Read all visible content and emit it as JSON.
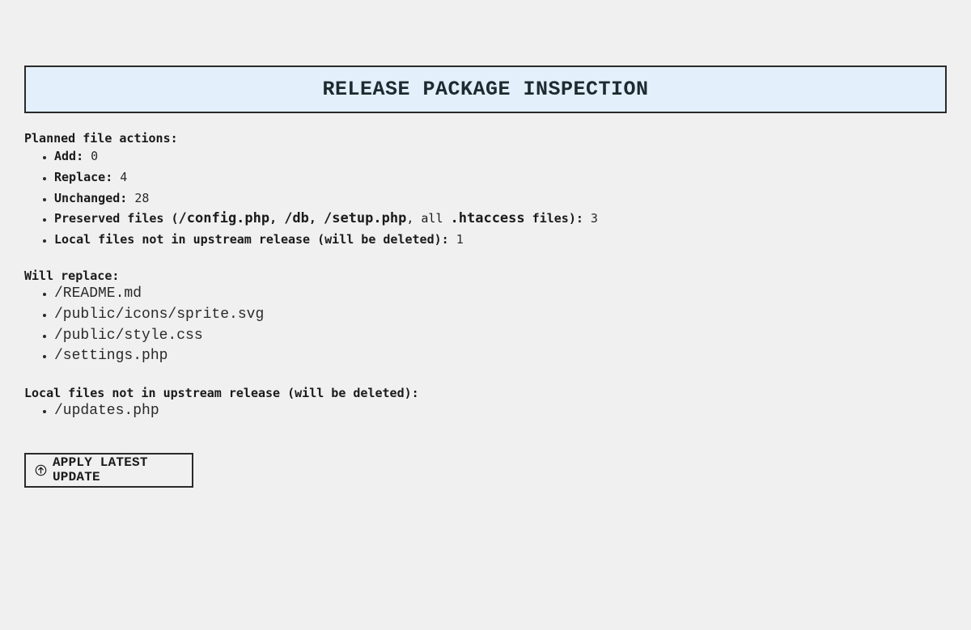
{
  "header": {
    "title": "RELEASE PACKAGE INSPECTION"
  },
  "planned": {
    "heading": "Planned file actions:",
    "add_label": "Add:",
    "add_value": "0",
    "replace_label": "Replace:",
    "replace_value": "4",
    "unchanged_label": "Unchanged:",
    "unchanged_value": "28",
    "preserved_prefix": "Preserved files (",
    "preserved_path_1": "/config.php",
    "preserved_sep_1": ", ",
    "preserved_path_2": "/db",
    "preserved_sep_2": ", ",
    "preserved_path_3": "/setup.php",
    "preserved_sep_3": ", all ",
    "preserved_path_4": ".htaccess",
    "preserved_suffix": " files):",
    "preserved_value": "3",
    "local_label": "Local files not in upstream release (will be deleted):",
    "local_value": "1"
  },
  "replace": {
    "heading": "Will replace:",
    "files": [
      "/README.md",
      "/public/icons/sprite.svg",
      "/public/style.css",
      "/settings.php"
    ]
  },
  "deleted": {
    "heading": "Local files not in upstream release (will be deleted):",
    "files": [
      "/updates.php"
    ]
  },
  "actions": {
    "apply_label": "APPLY LATEST UPDATE",
    "apply_icon": "upload-circle-icon"
  }
}
